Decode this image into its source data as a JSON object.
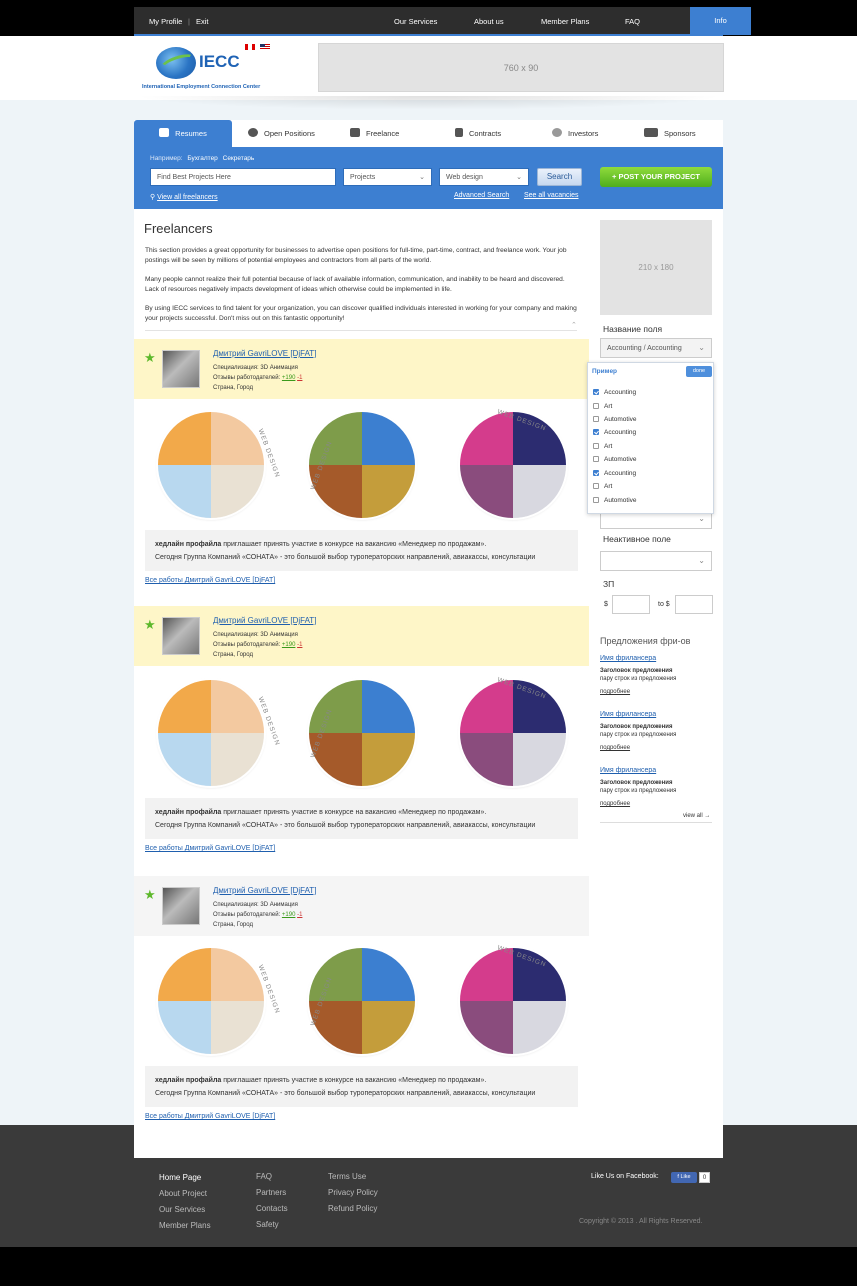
{
  "topnav": {
    "my_profile": "My Profile",
    "exit": "Exit",
    "separator": "|",
    "our_services": "Our Services",
    "about_us": "About us",
    "member_plans": "Member Plans",
    "faq": "FAQ",
    "info": "Info"
  },
  "header": {
    "logo_text": "IECC",
    "logo_sub": "International Employment Connection Center",
    "banner": "760 x 90"
  },
  "tabs": [
    "Resumes",
    "Open Positions",
    "Freelance",
    "Contracts",
    "Investors",
    "Sponsors"
  ],
  "search": {
    "example_label": "Например:",
    "example_1": "Бухгалтер",
    "example_2": "Секретарь",
    "placeholder": "Find Best Projects Here",
    "category": "Projects",
    "subcategory": "Web design",
    "search_button": "Search",
    "post_button": "POST YOUR PROJECT",
    "view_all": "View all freelancers",
    "advanced": "Advanced Search",
    "see_all": "See all vacancies"
  },
  "intro": {
    "title": "Freelancers",
    "p1": "This section provides a great opportunity for businesses to advertise open positions for full-time, part-time, contract, and freelance work. Your job postings will be seen by millions of potential employees and contractors from all parts of the world.",
    "p2": "Many people cannot realize their full potential because of lack of available information, communication, and inability to be heard and discovered. Lack of resources negatively impacts development of ideas which otherwise could be implemented in life.",
    "p3": "By using IECC services to find talent for your organization, you can discover qualified individuals interested in working for your company and making your projects successful. Don't miss out on this fantastic opportunity!"
  },
  "cards": [
    {
      "name": "Дмитрий GavriLOVE [DjFAT]",
      "spec": "Специализация: 3D Анимация",
      "reviews_label": "Отзывы работодателей:",
      "pos": "+190",
      "neg": "-1",
      "location": "Страна, Город",
      "quote_bold": "хедлайн профайла",
      "quote_line1": " приглашает принять участие в конкурсе на вакансию «Менеджер по продажам».",
      "quote_line2": "Сегодня Группа Компаний «СОНАТА» - это большой выбор туроператорских направлений, авиакассы, консультации",
      "all_works": "Все работы Дмитрий GavriLOVE [DjFAT]"
    },
    {
      "name": "Дмитрий GavriLOVE [DjFAT]",
      "spec": "Специализация: 3D Анимация",
      "reviews_label": "Отзывы работодателей:",
      "pos": "+190",
      "neg": "-1",
      "location": "Страна, Город",
      "quote_bold": "хедлайн профайла",
      "quote_line1": " приглашает принять участие в конкурсе на вакансию «Менеджер по продажам».",
      "quote_line2": "Сегодня Группа Компаний «СОНАТА» - это большой выбор туроператорских направлений, авиакассы, консультации",
      "all_works": "Все работы Дмитрий GavriLOVE [DjFAT]"
    },
    {
      "name": "Дмитрий GavriLOVE [DjFAT]",
      "spec": "Специализация: 3D Анимация",
      "reviews_label": "Отзывы работодателей:",
      "pos": "+190",
      "neg": "-1",
      "location": "Страна, Город",
      "quote_bold": "хедлайн профайла",
      "quote_line1": " приглашает принять участие в конкурсе на вакансию «Менеджер по продажам».",
      "quote_line2": "Сегодня Группа Компаний «СОНАТА» - это большой выбор туроператорских направлений, авиакассы, консультации",
      "all_works": "Все работы Дмитрий GavriLOVE [DjFAT]"
    }
  ],
  "portfolio_caption": "WEB DESIGN",
  "sidebar": {
    "ad": "210 x 180",
    "field_label": "Название поля",
    "field_value": "Accounting / Accounting",
    "dropdown_title": "Пример",
    "dropdown_done": "done",
    "dropdown_items": [
      {
        "label": "Accounting",
        "checked": true
      },
      {
        "label": "Art",
        "checked": false
      },
      {
        "label": "Automotive",
        "checked": false
      },
      {
        "label": "Accounting",
        "checked": true
      },
      {
        "label": "Art",
        "checked": false
      },
      {
        "label": "Automotive",
        "checked": false
      },
      {
        "label": "Accounting",
        "checked": true
      },
      {
        "label": "Art",
        "checked": false
      },
      {
        "label": "Automotive",
        "checked": false
      }
    ],
    "inactive_label": "Неактивное поле",
    "salary_label": "ЗП",
    "salary_from": "$",
    "salary_to": "to $",
    "offers_title": "Предложения фри-ов",
    "offers": [
      {
        "name": "Имя фрилансера",
        "title": "Заголовок предложения",
        "text": "пару строк из предложения",
        "more": "подробнее"
      },
      {
        "name": "Имя фрилансера",
        "title": "Заголовок предложения",
        "text": "пару строк из предложения",
        "more": "подробнее"
      },
      {
        "name": "Имя фрилансера",
        "title": "Заголовок предложения",
        "text": "пару строк из предложения",
        "more": "подробнее"
      }
    ],
    "view_all": "view all →"
  },
  "footer": {
    "col1": [
      "Home Page",
      "About Project",
      "Our Services",
      "Member Plans"
    ],
    "col2": [
      "FAQ",
      "Partners",
      "Contacts",
      "Safety"
    ],
    "col3": [
      "Terms Use",
      "Privacy Policy",
      "Refund Policy"
    ],
    "fb_label": "Like Us on Facebook:",
    "fb_like": "Like",
    "fb_count": "0",
    "copyright": "Copyright © 2013 . All Rights Reserved."
  },
  "colors": {
    "accent": "#3d7fd1",
    "post_button": "#5db82b",
    "card_highlight": "#fef6c8"
  }
}
